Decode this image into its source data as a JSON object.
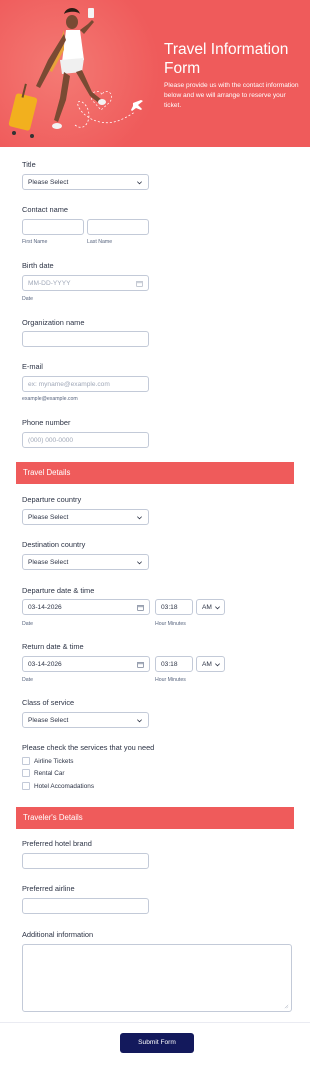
{
  "header": {
    "title": "Travel Information Form",
    "subtitle": "Please provide us with the contact information below and we will arrange to reserve your ticket."
  },
  "fields": {
    "title": {
      "label": "Title",
      "value": "Please Select"
    },
    "contact_name": {
      "label": "Contact name",
      "first": "First Name",
      "last": "Last Name"
    },
    "birth_date": {
      "label": "Birth date",
      "placeholder": "MM-DD-YYYY",
      "sub": "Date"
    },
    "organization": {
      "label": "Organization name"
    },
    "email": {
      "label": "E-mail",
      "placeholder": "ex: myname@example.com",
      "sub": "example@example.com"
    },
    "phone": {
      "label": "Phone number",
      "placeholder": "(000) 000-0000"
    }
  },
  "travel": {
    "section_title": "Travel Details",
    "departure_country": {
      "label": "Departure country",
      "value": "Please Select"
    },
    "destination_country": {
      "label": "Destination country",
      "value": "Please Select"
    },
    "departure_datetime": {
      "label": "Departure date & time",
      "date": "03-14-2026",
      "time": "03:18",
      "ampm": "AM",
      "date_sub": "Date",
      "time_sub": "Hour Minutes"
    },
    "return_datetime": {
      "label": "Return date & time",
      "date": "03-14-2026",
      "time": "03:18",
      "ampm": "AM",
      "date_sub": "Date",
      "time_sub": "Hour Minutes"
    },
    "class_of_service": {
      "label": "Class of service",
      "value": "Please Select"
    },
    "services": {
      "label": "Please check the services that you need",
      "options": [
        "Airline Tickets",
        "Rental Car",
        "Hotel Accomadations"
      ]
    }
  },
  "traveler": {
    "section_title": "Traveler's Details",
    "hotel_brand": {
      "label": "Preferred hotel brand"
    },
    "airline": {
      "label": "Preferred airline"
    },
    "additional": {
      "label": "Additional information"
    }
  },
  "submit_label": "Submit Form",
  "colors": {
    "accent": "#ef5b5b",
    "submit": "#13195c",
    "border": "#c3cad8"
  }
}
